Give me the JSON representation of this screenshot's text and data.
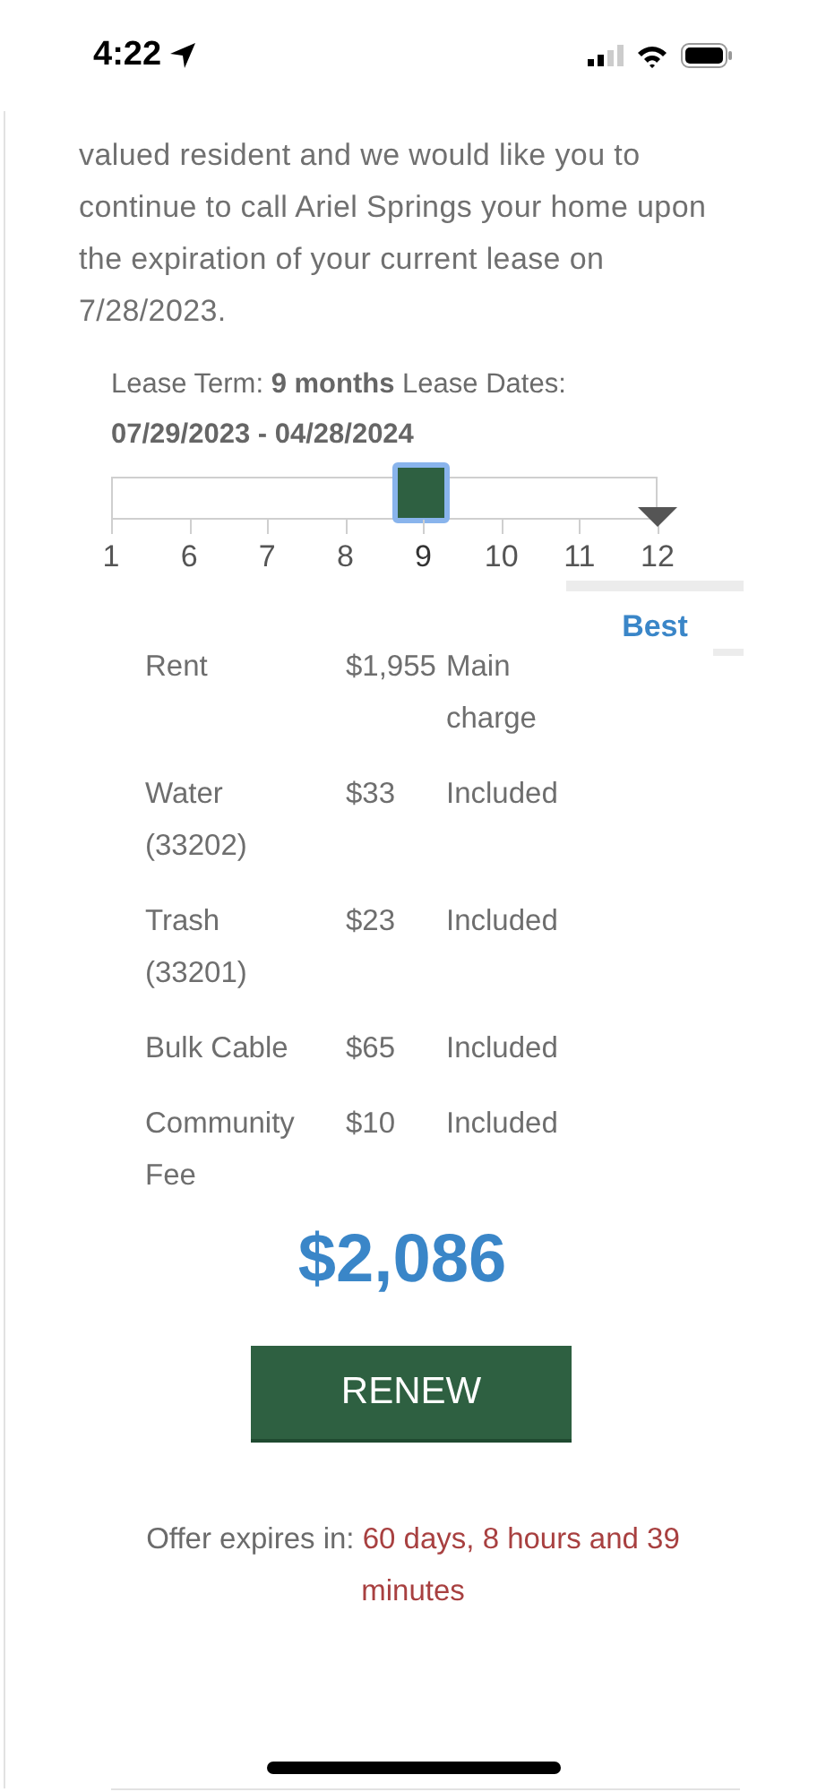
{
  "status_bar": {
    "time": "4:22"
  },
  "intro": "valued resident and we would like you to continue to call Ariel Springs your home upon the expiration of your current lease on 7/28/2023.",
  "lease": {
    "term_label": "Lease Term:",
    "term_value": "9 months",
    "dates_label": "Lease Dates:",
    "dates_value": "07/29/2023 - 04/28/2024"
  },
  "slider": {
    "level": 0.571,
    "stops": [
      {
        "label": "1",
        "selected": false,
        "best": false
      },
      {
        "label": "6",
        "selected": false,
        "best": false
      },
      {
        "label": "7",
        "selected": false,
        "best": false
      },
      {
        "label": "8",
        "selected": false,
        "best": false
      },
      {
        "label": "9",
        "selected": true,
        "best": false
      },
      {
        "label": "10",
        "selected": false,
        "best": false
      },
      {
        "label": "11",
        "selected": false,
        "best": false
      },
      {
        "label": "12",
        "selected": false,
        "best": true
      }
    ]
  },
  "best_value_label": "Best",
  "charges": [
    {
      "name": "Rent",
      "amount": "$1,955",
      "note": "Main charge"
    },
    {
      "name": "Water (33202)",
      "amount": "$33",
      "note": "Included"
    },
    {
      "name": "Trash (33201)",
      "amount": "$23",
      "note": "Included"
    },
    {
      "name": "Bulk Cable",
      "amount": "$65",
      "note": "Included"
    },
    {
      "name": "Community Fee",
      "amount": "$10",
      "note": "Included"
    }
  ],
  "total": "$2,086",
  "renew_button": "RENEW",
  "offer": {
    "label": "Offer expires in:",
    "value": "60 days, 8 hours and 39 minutes"
  }
}
